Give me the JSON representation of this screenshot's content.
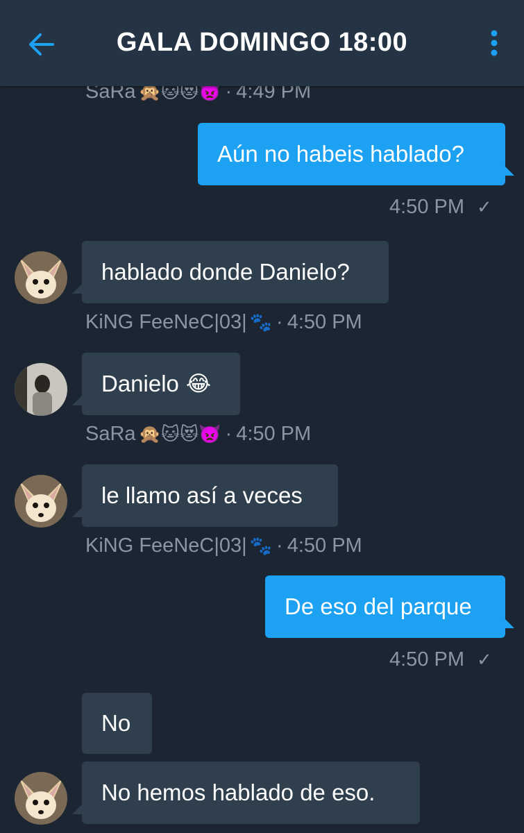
{
  "header": {
    "title": "GALA DOMINGO 18:00",
    "back_icon": "arrow-left-icon",
    "menu_icon": "more-vertical-icon",
    "accent": "#1da1f2"
  },
  "colors": {
    "background": "#1b2632",
    "header": "#243444",
    "incoming_bubble": "#2f3f4d",
    "outgoing_bubble": "#1da1f2",
    "meta_text": "#8a97a3"
  },
  "messages": [
    {
      "kind": "meta",
      "sender": "SaRa",
      "emojis": "🙊🐱😻👿",
      "time": "4:49 PM"
    },
    {
      "kind": "outgoing",
      "text": "Aún no habeis hablado?",
      "time": "4:50 PM",
      "status_icon": "check-icon"
    },
    {
      "kind": "incoming",
      "avatar": "fennec-fox-avatar",
      "text": "hablado donde Danielo?",
      "sender": "KiNG FeeNeC|03|",
      "sender_emoji": "🐾",
      "time": "4:50 PM"
    },
    {
      "kind": "incoming",
      "avatar": "selfie-avatar",
      "text": "Danielo",
      "text_emoji": "😂",
      "sender": "SaRa",
      "emojis": "🙊🐱😻👿",
      "time": "4:50 PM"
    },
    {
      "kind": "incoming",
      "avatar": "fennec-fox-avatar",
      "text": "le llamo así a veces",
      "sender": "KiNG FeeNeC|03|",
      "sender_emoji": "🐾",
      "time": "4:50 PM"
    },
    {
      "kind": "outgoing",
      "text": "De eso del parque",
      "time": "4:50 PM",
      "status_icon": "check-icon"
    },
    {
      "kind": "incoming",
      "text": "No"
    },
    {
      "kind": "incoming",
      "avatar": "fennec-fox-avatar",
      "text": "No hemos hablado de eso."
    }
  ]
}
